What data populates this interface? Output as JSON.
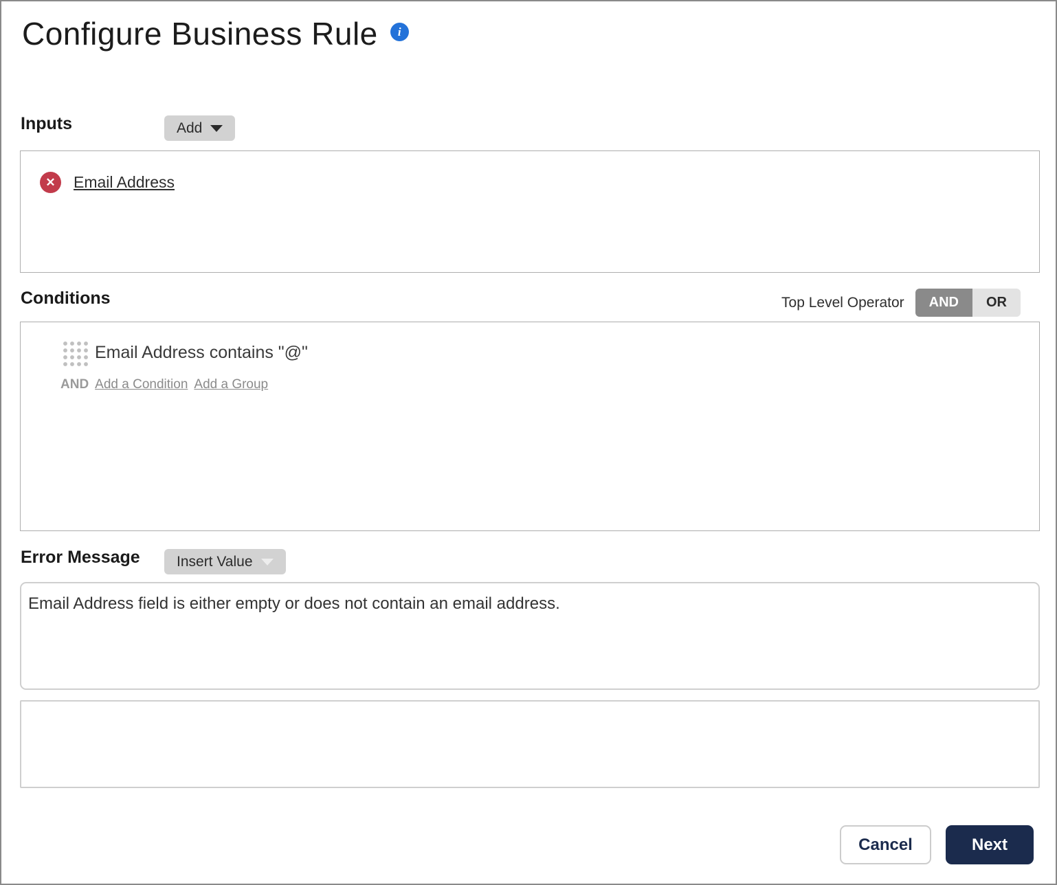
{
  "page": {
    "title": "Configure Business Rule",
    "info_icon_glyph": "i"
  },
  "inputs": {
    "label": "Inputs",
    "add_button_label": "Add",
    "items": [
      {
        "name": "Email Address",
        "delete_icon_glyph": "✕"
      }
    ]
  },
  "conditions": {
    "label": "Conditions",
    "top_level_operator_label": "Top Level Operator",
    "operators": [
      {
        "label": "AND",
        "selected": true
      },
      {
        "label": "OR",
        "selected": false
      }
    ],
    "rows": [
      {
        "text": "Email Address contains \"@\""
      }
    ],
    "and_label": "AND",
    "add_condition_link": "Add a Condition",
    "add_group_link": "Add a Group"
  },
  "error_message": {
    "label": "Error Message",
    "insert_value_button_label": "Insert Value",
    "value": "Email Address field is either empty or does not contain an email address."
  },
  "footer": {
    "cancel_label": "Cancel",
    "next_label": "Next"
  },
  "colors": {
    "accent_navy": "#1b2b4d",
    "delete_red": "#c23b4b",
    "info_blue": "#2372d9",
    "button_gray": "#d2d2d2",
    "toggle_selected_gray": "#8a8a8a",
    "toggle_unselected_gray": "#e3e3e3",
    "panel_border": "#adadad",
    "outer_border": "#8a8a8a"
  }
}
